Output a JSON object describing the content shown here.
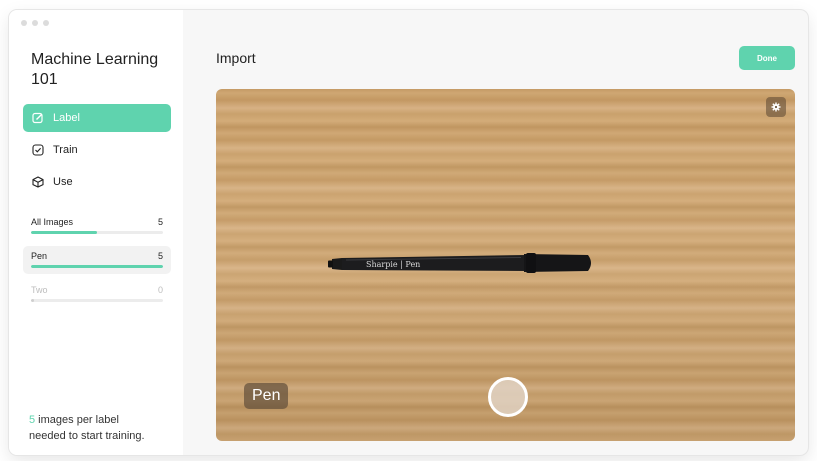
{
  "app": {
    "title": "Machine Learning 101"
  },
  "sidebar": {
    "nav": [
      {
        "label": "Label",
        "icon": "edit-icon",
        "active": true
      },
      {
        "label": "Train",
        "icon": "check-square-icon",
        "active": false
      },
      {
        "label": "Use",
        "icon": "cube-icon",
        "active": false
      }
    ],
    "labels": [
      {
        "name": "All Images",
        "count": "5",
        "progress": 0.5
      },
      {
        "name": "Pen",
        "count": "5",
        "progress": 1.0
      },
      {
        "name": "Two",
        "count": "0",
        "progress": 0.0
      }
    ],
    "hint": {
      "count": "5",
      "text_line1": " images per label",
      "text_line2": "needed to start training."
    }
  },
  "main": {
    "title": "Import",
    "done_label": "Done",
    "current_label": "Pen",
    "pen_brand_text": "Sharpie | Pen",
    "settings_icon": "gear-icon"
  },
  "colors": {
    "accent": "#5fd3ae"
  }
}
